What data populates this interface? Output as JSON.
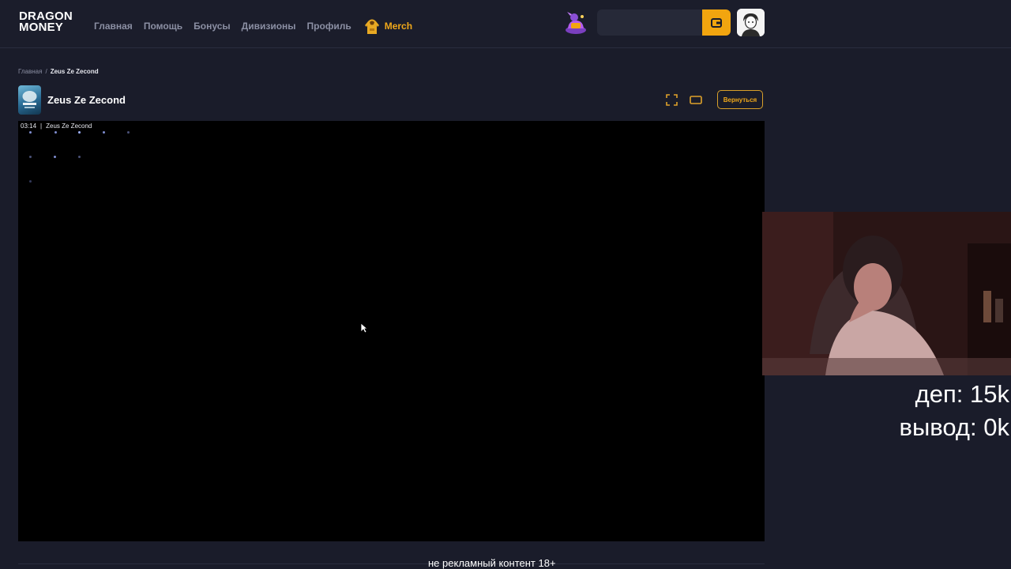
{
  "header": {
    "logo_line1": "DRAGON",
    "logo_line2": "MONEY",
    "nav": [
      "Главная",
      "Помощь",
      "Бонусы",
      "Дивизионы",
      "Профиль"
    ],
    "merch_label": "Merch"
  },
  "breadcrumb": {
    "home": "Главная",
    "separator": "/",
    "current": "Zeus Ze Zecond"
  },
  "game": {
    "title": "Zeus Ze Zecond",
    "back_label": "Вернуться",
    "timer": "03:14",
    "frame_label": "Zeus Ze Zecond"
  },
  "stream": {
    "deposit": "деп: 15k",
    "withdrawal": "вывод: 0k",
    "disclaimer": "не рекламный контент 18+"
  },
  "colors": {
    "background": "#1a1c2a",
    "accent": "#f2a50f",
    "nav_text": "#8b8fa3",
    "game_area": "#000000"
  }
}
